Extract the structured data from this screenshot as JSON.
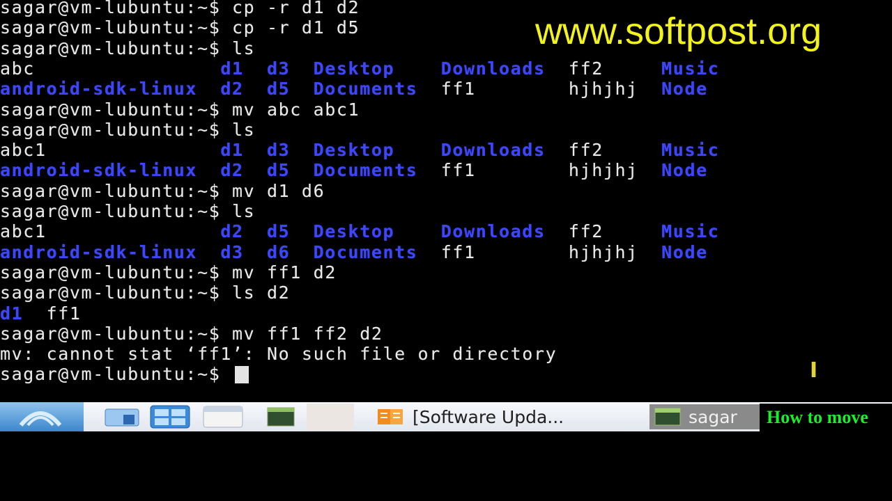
{
  "watermark": "www.softpost.org",
  "terminal": {
    "lines": [
      [
        {
          "t": "sagar@vm-lubuntu:~$ cp -r d1 d2",
          "c": "plain"
        }
      ],
      [
        {
          "t": "sagar@vm-lubuntu:~$ cp -r d1 d5",
          "c": "plain"
        }
      ],
      [
        {
          "t": "sagar@vm-lubuntu:~$ ls",
          "c": "plain"
        }
      ],
      [
        {
          "t": "abc                ",
          "c": "plain"
        },
        {
          "t": "d1  d3  Desktop    Downloads",
          "c": "dir"
        },
        {
          "t": "  ff2     ",
          "c": "plain"
        },
        {
          "t": "Music",
          "c": "dir"
        }
      ],
      [
        {
          "t": "android-sdk-linux  d2  d5  Documents",
          "c": "dir"
        },
        {
          "t": "  ff1        hjhjhj  ",
          "c": "plain"
        },
        {
          "t": "Node",
          "c": "dir"
        }
      ],
      [
        {
          "t": "sagar@vm-lubuntu:~$ mv abc abc1",
          "c": "plain"
        }
      ],
      [
        {
          "t": "sagar@vm-lubuntu:~$ ls",
          "c": "plain"
        }
      ],
      [
        {
          "t": "abc1               ",
          "c": "plain"
        },
        {
          "t": "d1  d3  Desktop    Downloads",
          "c": "dir"
        },
        {
          "t": "  ff2     ",
          "c": "plain"
        },
        {
          "t": "Music",
          "c": "dir"
        }
      ],
      [
        {
          "t": "android-sdk-linux  d2  d5  Documents",
          "c": "dir"
        },
        {
          "t": "  ff1        hjhjhj  ",
          "c": "plain"
        },
        {
          "t": "Node",
          "c": "dir"
        }
      ],
      [
        {
          "t": "sagar@vm-lubuntu:~$ mv d1 d6",
          "c": "plain"
        }
      ],
      [
        {
          "t": "sagar@vm-lubuntu:~$ ls",
          "c": "plain"
        }
      ],
      [
        {
          "t": "abc1               ",
          "c": "plain"
        },
        {
          "t": "d2  d5  Desktop    Downloads",
          "c": "dir"
        },
        {
          "t": "  ff2     ",
          "c": "plain"
        },
        {
          "t": "Music",
          "c": "dir"
        }
      ],
      [
        {
          "t": "android-sdk-linux  d3  d6  Documents",
          "c": "dir"
        },
        {
          "t": "  ff1        hjhjhj  ",
          "c": "plain"
        },
        {
          "t": "Node",
          "c": "dir"
        }
      ],
      [
        {
          "t": "sagar@vm-lubuntu:~$ mv ff1 d2",
          "c": "plain"
        }
      ],
      [
        {
          "t": "sagar@vm-lubuntu:~$ ls d2",
          "c": "plain"
        }
      ],
      [
        {
          "t": "d1",
          "c": "dir"
        },
        {
          "t": "  ff1",
          "c": "plain"
        }
      ],
      [
        {
          "t": "sagar@vm-lubuntu:~$ mv ff1 ff2 d2",
          "c": "plain"
        }
      ],
      [
        {
          "t": "mv: cannot stat ‘ff1’: No such file or directory",
          "c": "plain"
        }
      ],
      [
        {
          "t": "sagar@vm-lubuntu:~$ ",
          "c": "plain"
        }
      ]
    ]
  },
  "taskbar": {
    "software_update_label": "[Software Upda...",
    "terminal_task_label": "sagar"
  },
  "caption": "How to move",
  "colors": {
    "directory": "#3c46ff",
    "text": "#e9e9e9",
    "watermark": "#f3f31c",
    "caption": "#19ef2a"
  }
}
